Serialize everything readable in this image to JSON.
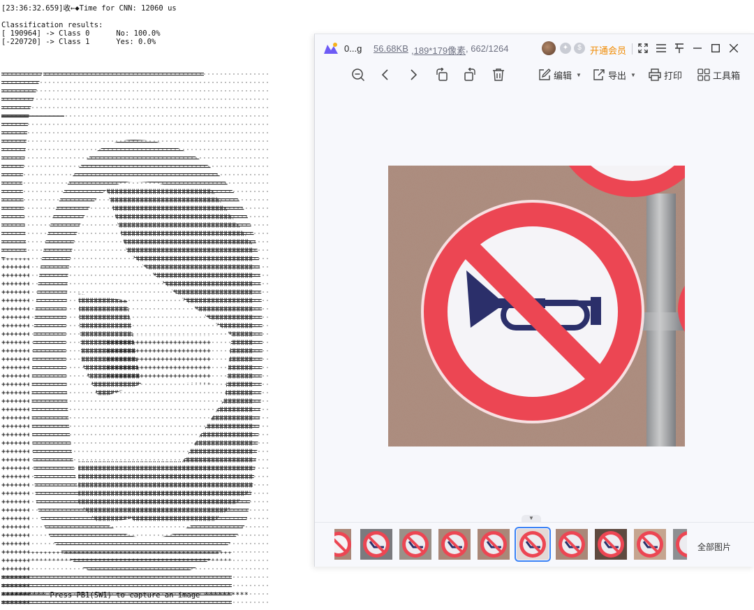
{
  "terminal": {
    "lines": [
      "[23:36:32.659]收←◆Time for CNN: 12060 us",
      "",
      "Classification results:",
      "[ 190964] -> Class 0      No: 100.0%",
      "[-220720] -> Class 1      Yes: 0.0%"
    ],
    "footer": "********** Press PB1(SW1) to capture an image **********"
  },
  "viewer": {
    "file_name": "0...g",
    "file_size": "56.68KB",
    "file_dims": ",189*179像素",
    "file_index": ", 662/1264",
    "vip_label": "开通会员",
    "toolbar": {
      "edit": "编辑",
      "export": "导出",
      "print": "打印",
      "toolbox": "工具箱"
    },
    "all_images": "全部图片",
    "thumbnail_count": 10,
    "selected_thumbnail": 6
  },
  "colors": {
    "accent": "#3b82f6",
    "vip": "#f08a00",
    "sign_red": "#ec4653",
    "horn_blue": "#2b2f6a",
    "wall": "#a98778"
  },
  "icons": [
    "app-logo-icon",
    "avatar",
    "badge-icon",
    "fullscreen-icon",
    "menu-icon",
    "pin-icon",
    "minimize-icon",
    "maximize-icon",
    "close-icon",
    "zoom-out-icon",
    "prev-icon",
    "next-icon",
    "rotate-left-icon",
    "rotate-right-icon",
    "delete-icon",
    "edit-icon",
    "export-icon",
    "print-icon",
    "toolbox-icon"
  ]
}
